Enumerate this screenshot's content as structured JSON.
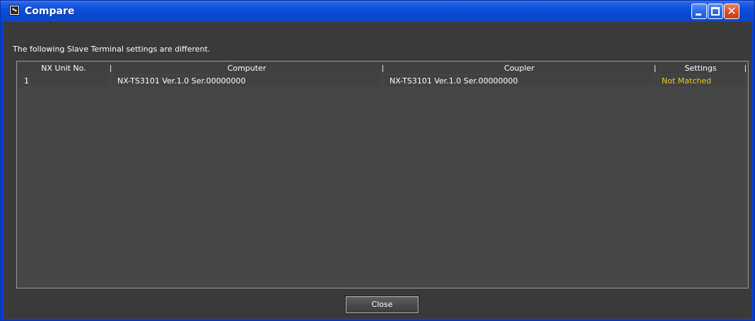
{
  "window": {
    "title": "Compare",
    "controls": {
      "minimize": "minimize-icon",
      "maximize": "maximize-icon",
      "close": "close-icon"
    }
  },
  "message": "The following Slave Terminal settings are different.",
  "table": {
    "columns": [
      "NX Unit No.",
      "Computer",
      "Coupler",
      "Settings"
    ],
    "rows": [
      {
        "unit_no": "1",
        "computer": "NX-TS3101 Ver.1.0 Ser.00000000",
        "coupler": "NX-TS3101 Ver.1.0 Ser.00000000",
        "settings": "Not Matched"
      }
    ]
  },
  "buttons": {
    "close_label": "Close"
  },
  "colors": {
    "title_bar": "#0b4ad4",
    "dialog_background": "#3a3a3b",
    "table_background": "#474747",
    "status_not_matched": "#e6c91d"
  }
}
